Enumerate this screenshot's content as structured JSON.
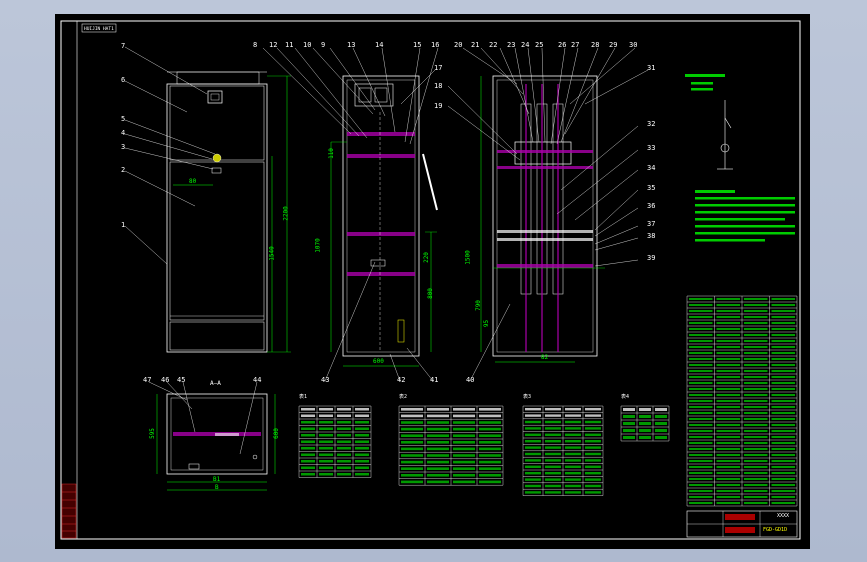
{
  "drawing": {
    "title_tag": "HUIJIN HAT1",
    "view_label_a": "A—A",
    "part_numbers_front_left": [
      "7",
      "6",
      "5",
      "4",
      "3",
      "2",
      "1"
    ],
    "part_numbers_top": [
      "8",
      "12",
      "11",
      "10",
      "9",
      "13",
      "14",
      "15",
      "16",
      "20",
      "21",
      "22",
      "23",
      "24",
      "25",
      "26",
      "27",
      "28",
      "29",
      "30"
    ],
    "part_numbers_right": [
      "31",
      "32",
      "33",
      "34",
      "35",
      "36",
      "37",
      "38",
      "39"
    ],
    "part_numbers_mid": [
      "17",
      "18",
      "19"
    ],
    "part_numbers_bottom": [
      "43",
      "42",
      "41",
      "40"
    ],
    "part_numbers_plan": [
      "47",
      "46",
      "45",
      "44"
    ],
    "dimensions": {
      "d2200": "2200",
      "d1540": "1540",
      "d80": "80",
      "d1070": "1070",
      "d110": "110",
      "d220": "220",
      "d800": "800",
      "d600": "600",
      "d1500": "1500",
      "d790": "790",
      "d95": "95",
      "d82": "82",
      "plan_w": "B",
      "plan_bw": "B1",
      "plan_d": "595",
      "plan_d2": "600"
    },
    "table_titles": [
      "表1",
      "表2",
      "表3",
      "表4"
    ],
    "title_block": "XXXX",
    "title_block_code": "FGD-GD1D"
  }
}
